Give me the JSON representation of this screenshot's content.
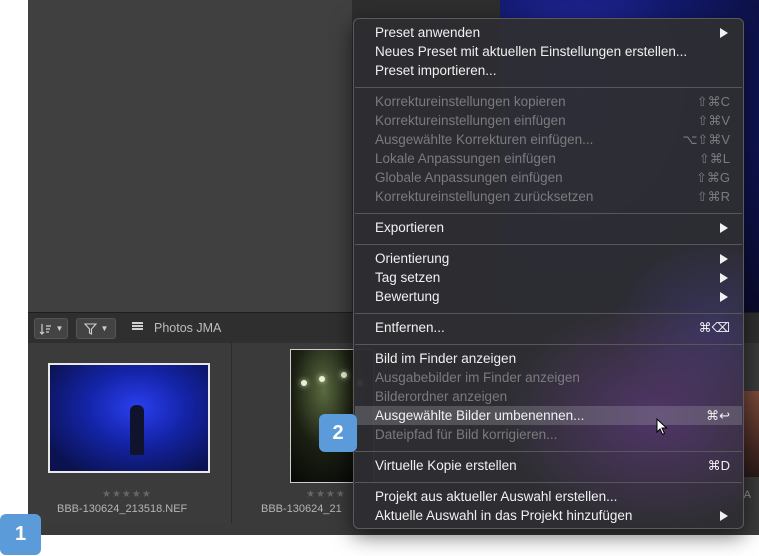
{
  "toolbar": {
    "sort_icon": "sort-icon",
    "filter_icon": "filter-icon",
    "grid_icon": "list-grid-icon",
    "title": "Photos JMA"
  },
  "browser": {
    "thumbnails": [
      {
        "filename": "BBB-130624_213518.NEF",
        "rating": "★★★★★"
      },
      {
        "filename": "BBB-130624_21",
        "rating": "★★★★"
      }
    ],
    "partial_label": "-A"
  },
  "badges": {
    "one": "1",
    "two": "2"
  },
  "menu": {
    "items": [
      {
        "label": "Preset anwenden",
        "submenu": true,
        "enabled": true
      },
      {
        "label": "Neues Preset mit aktuellen Einstellungen erstellen...",
        "enabled": true
      },
      {
        "label": "Preset importieren...",
        "enabled": true
      },
      {
        "label": "Korrektureinstellungen kopieren",
        "shortcut": "⇧⌘C",
        "enabled": false
      },
      {
        "label": "Korrektureinstellungen einfügen",
        "shortcut": "⇧⌘V",
        "enabled": false
      },
      {
        "label": "Ausgewählte Korrekturen einfügen...",
        "shortcut": "⌥⇧⌘V",
        "enabled": false
      },
      {
        "label": "Lokale Anpassungen einfügen",
        "shortcut": "⇧⌘L",
        "enabled": false
      },
      {
        "label": "Globale Anpassungen einfügen",
        "shortcut": "⇧⌘G",
        "enabled": false
      },
      {
        "label": "Korrektureinstellungen zurücksetzen",
        "shortcut": "⇧⌘R",
        "enabled": false
      },
      {
        "label": "Exportieren",
        "submenu": true,
        "enabled": true
      },
      {
        "label": "Orientierung",
        "submenu": true,
        "enabled": true
      },
      {
        "label": "Tag setzen",
        "submenu": true,
        "enabled": true
      },
      {
        "label": "Bewertung",
        "submenu": true,
        "enabled": true
      },
      {
        "label": "Entfernen...",
        "shortcut": "⌘⌫",
        "enabled": true
      },
      {
        "label": "Bild im Finder anzeigen",
        "enabled": true
      },
      {
        "label": "Ausgabebilder im Finder anzeigen",
        "enabled": false
      },
      {
        "label": "Bilderordner anzeigen",
        "enabled": false
      },
      {
        "label": "Ausgewählte Bilder umbenennen...",
        "shortcut": "⌘↩",
        "enabled": true,
        "highlighted": true
      },
      {
        "label": "Dateipfad für Bild korrigieren...",
        "enabled": false
      },
      {
        "label": "Virtuelle Kopie erstellen",
        "shortcut": "⌘D",
        "enabled": true
      },
      {
        "label": "Projekt aus aktueller Auswahl erstellen...",
        "enabled": true
      },
      {
        "label": "Aktuelle Auswahl in das Projekt hinzufügen",
        "submenu": true,
        "enabled": true
      }
    ]
  }
}
